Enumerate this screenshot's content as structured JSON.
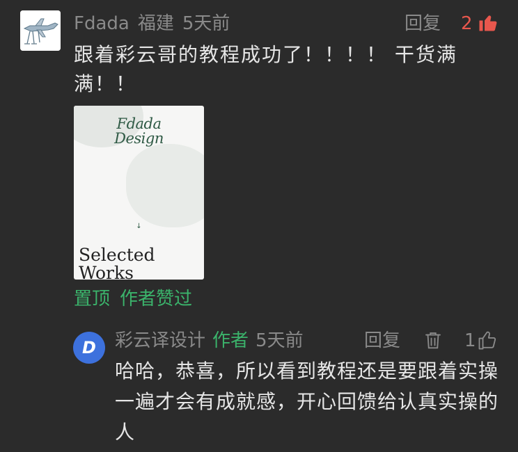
{
  "comment": {
    "user_name": "Fdada",
    "location": "福建",
    "time": "5天前",
    "reply_label": "回复",
    "like_count": "2",
    "text": "跟着彩云哥的教程成功了！！！！ 干货满满！！",
    "badges": [
      "置顶",
      "作者赞过"
    ],
    "attachment": {
      "brand_line1": "Fdada",
      "brand_line2": "Design",
      "arrow": "↓",
      "title_line1": "Selected",
      "title_line2": "Works"
    }
  },
  "reply": {
    "avatar_letter": "D",
    "user_name": "彩云译设计",
    "author_tag": "作者",
    "time": "5天前",
    "reply_label": "回复",
    "like_count": "1",
    "text": "哈哈，恭喜，所以看到教程还是要跟着实操一遍才会有成就感，开心回馈给认真实操的人"
  },
  "colors": {
    "background": "#2b2b2b",
    "meta": "#8a8a8a",
    "text": "#e6e6e6",
    "green": "#3bb36b",
    "liked": "#e8574d",
    "avatar_blue": "#3d71dd"
  }
}
